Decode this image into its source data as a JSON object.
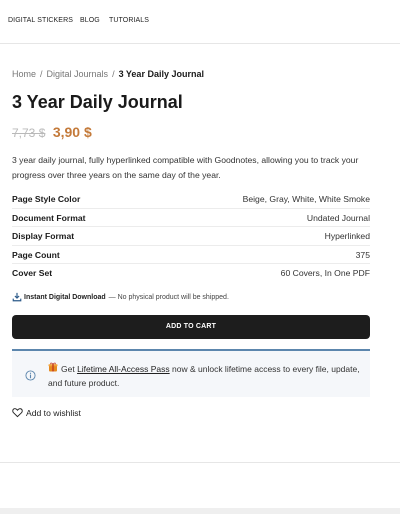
{
  "nav": {
    "items": [
      "DIGITAL STICKERS",
      "BLOG",
      "TUTORIALS"
    ]
  },
  "breadcrumb": {
    "home": "Home",
    "sep": "/",
    "category": "Digital Journals",
    "current": "3 Year Daily Journal"
  },
  "product": {
    "title": "3 Year Daily Journal",
    "price_old": "7,73 $",
    "price_new": "3,90 $",
    "description": "3 year daily journal, fully hyperlinked compatible with Goodnotes, allowing you to track your progress over three years on the same day of the year."
  },
  "specs": [
    {
      "label": "Page Style Color",
      "value": "Beige, Gray, White, White Smoke"
    },
    {
      "label": "Document Format",
      "value": "Undated Journal"
    },
    {
      "label": "Display Format",
      "value": "Hyperlinked"
    },
    {
      "label": "Page Count",
      "value": "375"
    },
    {
      "label": "Cover Set",
      "value": "60 Covers, In One PDF"
    }
  ],
  "download": {
    "bold": "Instant Digital Download",
    "note": "— No physical product will be shipped."
  },
  "cart": {
    "label": "ADD TO CART"
  },
  "promo": {
    "prefix": "Get ",
    "link": "Lifetime All-Access Pass",
    "suffix": " now & unlock lifetime access to every file, update, and future product."
  },
  "wishlist": {
    "label": "Add to wishlist"
  },
  "colors": {
    "accent_price": "#c47a3a",
    "button_bg": "#1d1d1d",
    "promo_border": "#5c86ad",
    "promo_bg": "#f5f7fa"
  },
  "icons": {
    "download": "download-icon",
    "info": "info-icon",
    "gift": "gift-icon",
    "wishlist": "heart-icon"
  }
}
